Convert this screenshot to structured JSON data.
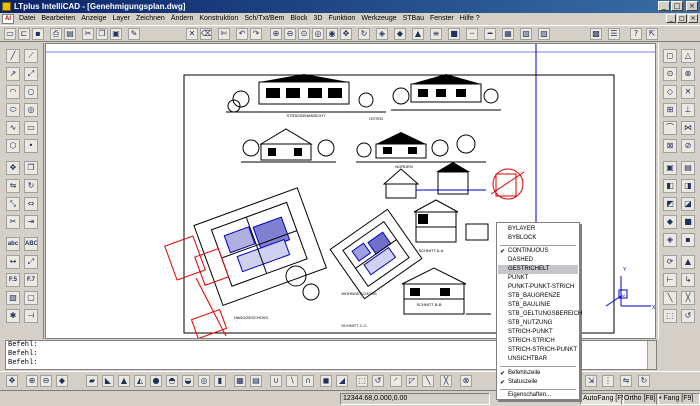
{
  "window": {
    "title": "LTplus IntelliCAD - [Genehmigungsplan.dwg]",
    "buttons": {
      "minimize": "_",
      "maximize": "□",
      "close": "×"
    }
  },
  "menubar": {
    "logo": "AI",
    "items": [
      "Datei",
      "Bearbeiten",
      "Anzeige",
      "Layer",
      "Zeichnen",
      "Ändern",
      "Konstruktion",
      "Sch/Txt/Bem",
      "Block",
      "3D",
      "Funktion",
      "Werkzeuge",
      "STBau",
      "Fenster",
      "Hilfe ?"
    ]
  },
  "drawing": {
    "labels": {
      "strassenansicht": "STRASSENANSICHT",
      "osten": "OSTEN",
      "norden": "NORDEN",
      "schnitt_aa": "SCHNITT A-A",
      "schnitt_bb": "SCHNITT B-B",
      "hanggeschoss": "HANGGESCHOSS",
      "wohngeschoss": "WOHNGESCHOSS",
      "schnitt_cc": "SCHNITT C-C"
    },
    "ucs": {
      "y": "Y",
      "w": "W",
      "x": "X"
    }
  },
  "command_line": {
    "lines": [
      "Befehl:",
      "Befehl:",
      "Befehl:"
    ]
  },
  "status_bar": {
    "coords": "12344.68,0.000,0.00",
    "autofang": "AutoFang [F5]",
    "ortho": "Ortho [F8]",
    "fang": "• Fang [F9]",
    "raster": "• Raster [F7]"
  },
  "context_menu": {
    "items": [
      {
        "label": "BYLAYER",
        "checked": false,
        "highlighted": false
      },
      {
        "label": "BYBLOCK",
        "checked": false,
        "highlighted": false
      },
      {
        "label": "CONTINUOUS",
        "checked": true,
        "highlighted": false
      },
      {
        "label": "DASHED",
        "checked": false,
        "highlighted": false
      },
      {
        "label": "GESTRICHELT",
        "checked": false,
        "highlighted": true
      },
      {
        "label": "PUNKT",
        "checked": false,
        "highlighted": false
      },
      {
        "label": "PUNKT-PUNKT-STRICH",
        "checked": false,
        "highlighted": false
      },
      {
        "label": "STB_BAUGRENZE",
        "checked": false,
        "highlighted": false
      },
      {
        "label": "STB_BAULINIE",
        "checked": false,
        "highlighted": false
      },
      {
        "label": "STB_GELTUNGSBEREICH",
        "checked": false,
        "highlighted": false
      },
      {
        "label": "STB_NUTZUNG",
        "checked": false,
        "highlighted": false
      },
      {
        "label": "STRICH-PUNKT",
        "checked": false,
        "highlighted": false
      },
      {
        "label": "STRICH-STRICH",
        "checked": false,
        "highlighted": false
      },
      {
        "label": "STRICH-STRICH-PUNKT",
        "checked": false,
        "highlighted": false
      },
      {
        "label": "UNSICHTBAR",
        "checked": false,
        "highlighted": false
      },
      {
        "label": "Befehlszeile",
        "checked": true,
        "highlighted": false
      },
      {
        "label": "Statuszeile",
        "checked": true,
        "highlighted": false
      },
      {
        "label": "Eigenschaften...",
        "checked": false,
        "highlighted": false
      }
    ]
  },
  "toolbar_top": {
    "icons": [
      "new-icon",
      "open-icon",
      "save-icon",
      "print-icon",
      "print-preview-icon",
      "cut-icon",
      "copy-icon",
      "paste-icon",
      "match-properties-icon",
      "delete-icon",
      "undo-icon",
      "redo-icon",
      "zoom-in-icon",
      "zoom-out-icon",
      "zoom-window-icon",
      "zoom-all-icon",
      "pan-icon",
      "redraw-icon",
      "view-icon",
      "render-icon",
      "layer-icon",
      "color-icon",
      "linetype-icon",
      "layer-panel-icon",
      "properties-icon",
      "help-icon"
    ]
  },
  "toolbar_left": {
    "labels": [
      "abc",
      "ABC",
      "F.5",
      "F.7"
    ]
  },
  "colors": {
    "titlebar_start": "#0a246a",
    "titlebar_end": "#3a6ea5",
    "face": "#d4d0c8",
    "drawing_bg": "#ffffff",
    "red_markup": "#e00000",
    "blue_hatch": "#0000c0"
  }
}
